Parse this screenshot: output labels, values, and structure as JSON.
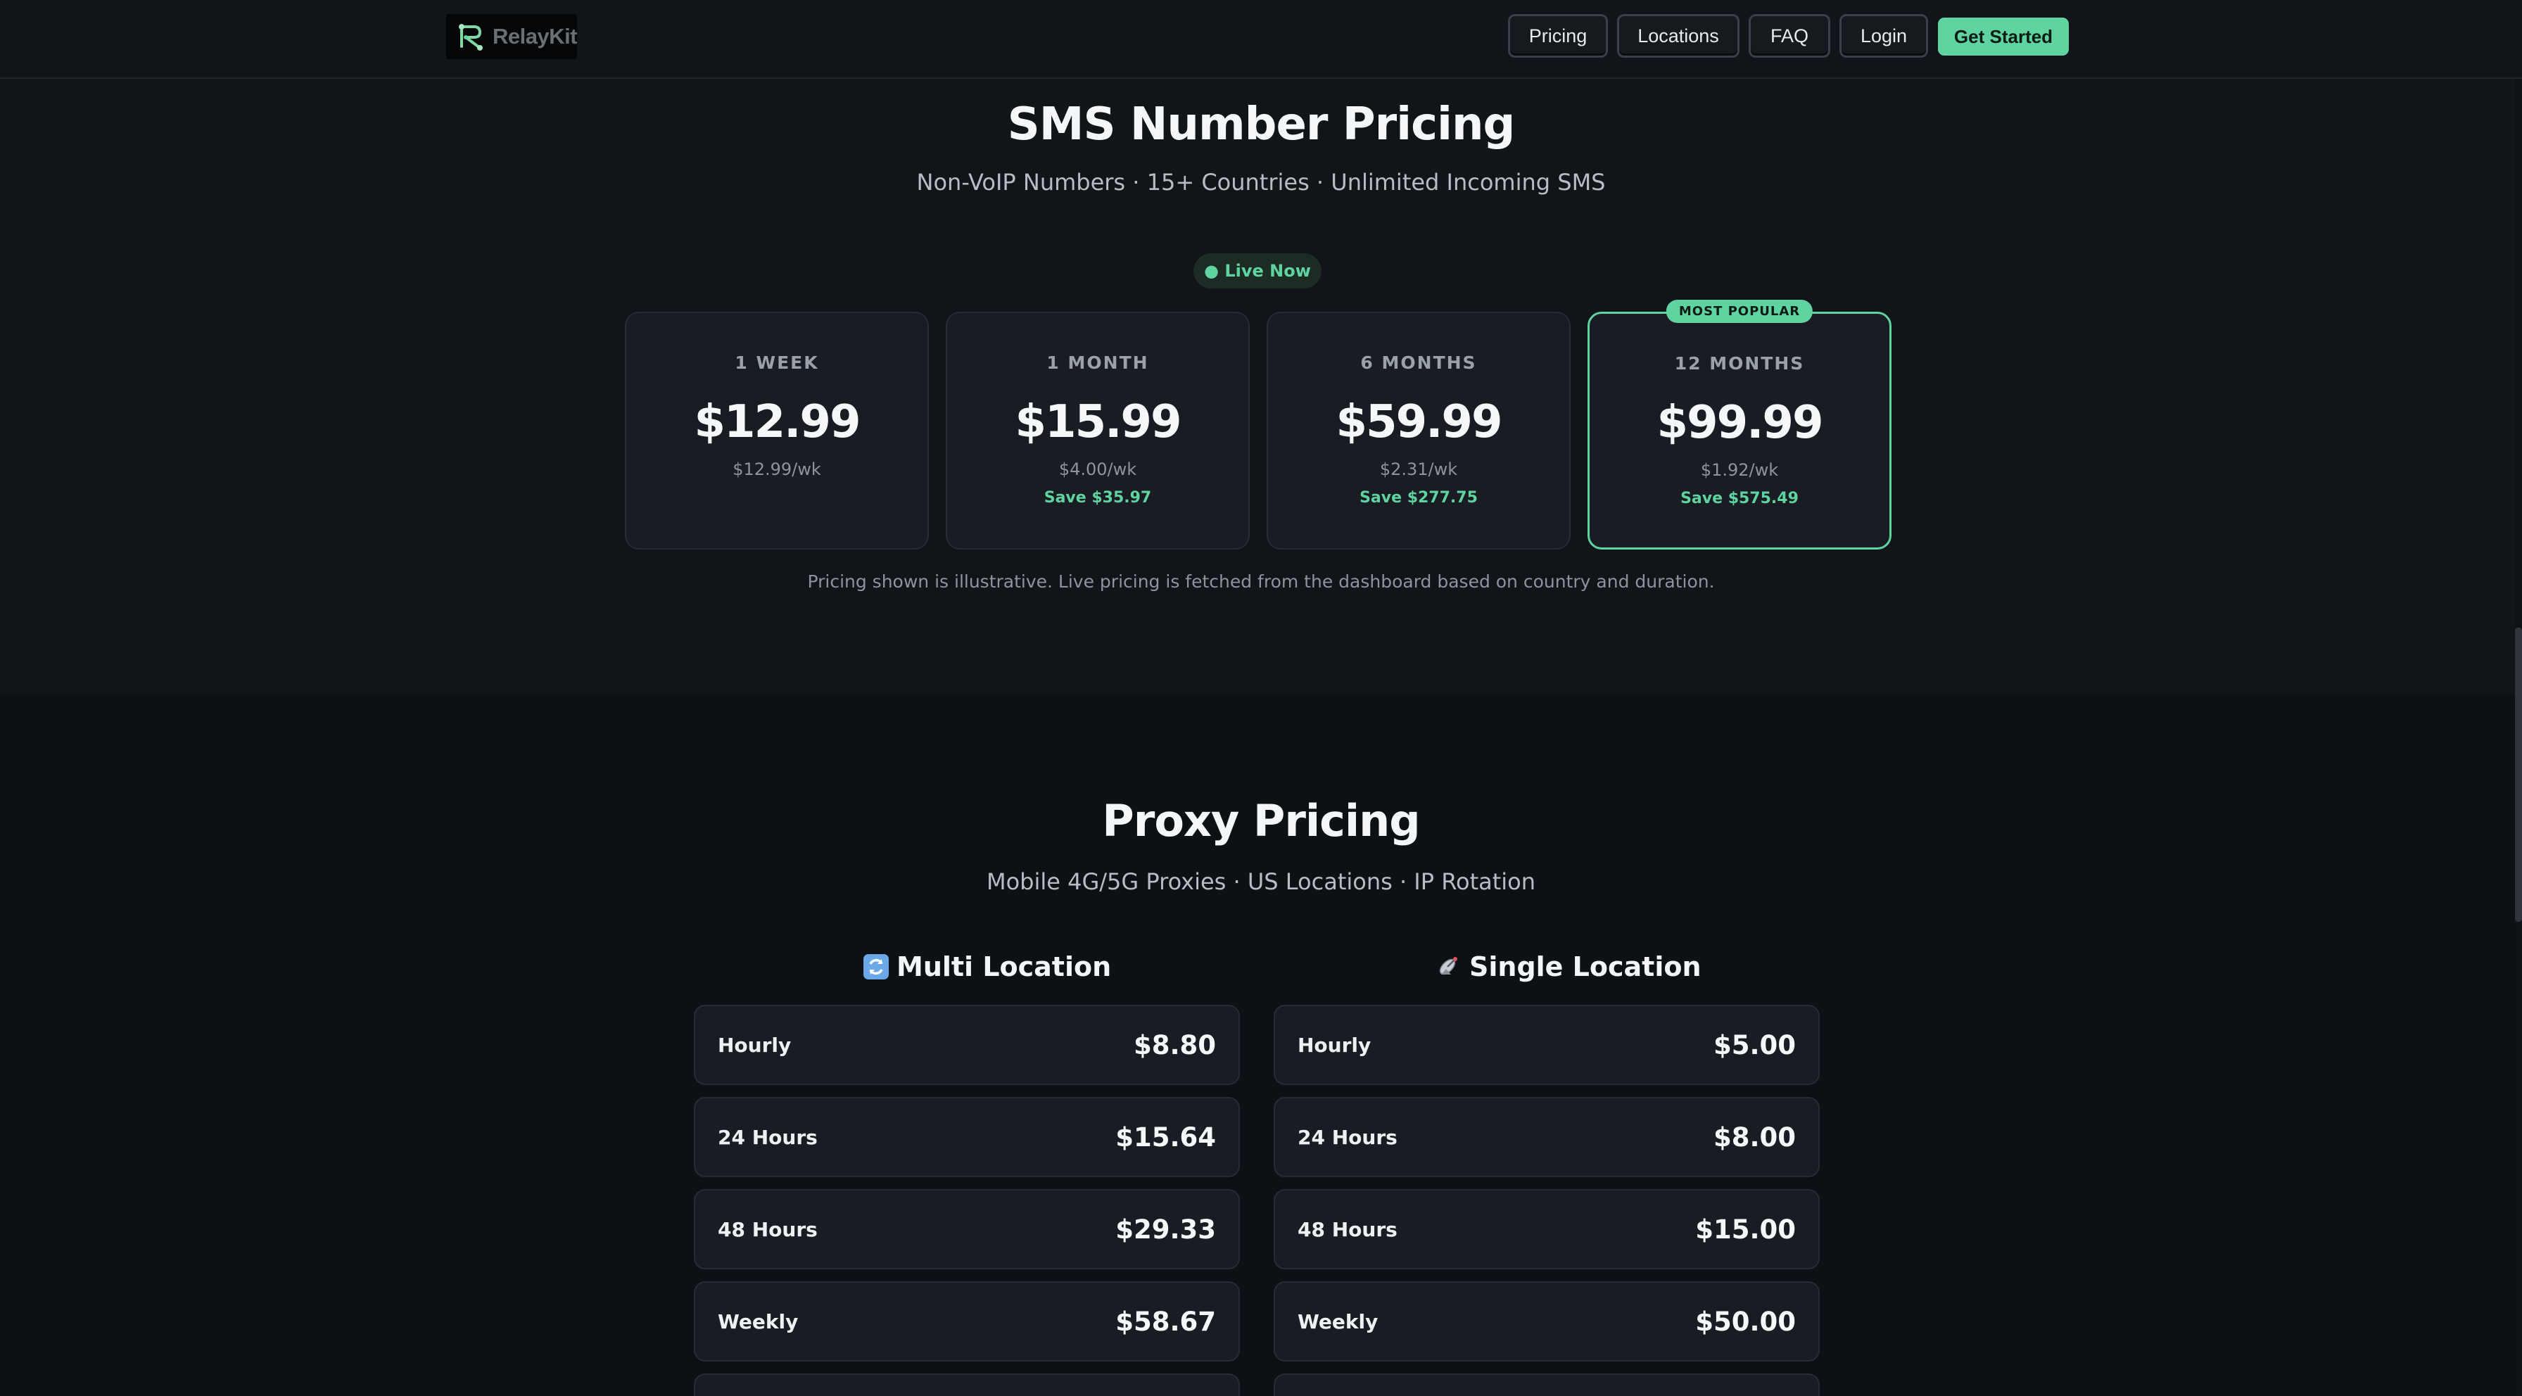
{
  "header": {
    "logo_text": "RelayKit",
    "nav": [
      "Pricing",
      "Locations",
      "FAQ",
      "Login"
    ],
    "cta_label": "Get Started"
  },
  "sms": {
    "title": "SMS Number Pricing",
    "subtitle": "Non-VoIP Numbers · 15+ Countries · Unlimited Incoming SMS",
    "live_badge": "● Live Now",
    "plans": [
      {
        "period": "1 WEEK",
        "price": "$12.99",
        "per_week": "$12.99/wk",
        "save": ""
      },
      {
        "period": "1 MONTH",
        "price": "$15.99",
        "per_week": "$4.00/wk",
        "save": "Save $35.97"
      },
      {
        "period": "6 MONTHS",
        "price": "$59.99",
        "per_week": "$2.31/wk",
        "save": "Save $277.75"
      },
      {
        "period": "12 MONTHS",
        "price": "$99.99",
        "per_week": "$1.92/wk",
        "save": "Save $575.49",
        "badge": "MOST POPULAR"
      }
    ],
    "note": "Pricing shown is illustrative. Live pricing is fetched from the dashboard based on country and duration."
  },
  "proxy": {
    "title": "Proxy Pricing",
    "subtitle": "Mobile 4G/5G Proxies · US Locations · IP Rotation",
    "multi": {
      "title": "Multi Location",
      "icon": "rotate-arrows-icon",
      "rows": [
        {
          "label": "Hourly",
          "price": "$8.80"
        },
        {
          "label": "24 Hours",
          "price": "$15.64"
        },
        {
          "label": "48 Hours",
          "price": "$29.33"
        },
        {
          "label": "Weekly",
          "price": "$58.67"
        }
      ]
    },
    "single": {
      "title": "Single Location",
      "icon": "satellite-antenna-icon",
      "rows": [
        {
          "label": "Hourly",
          "price": "$5.00"
        },
        {
          "label": "24 Hours",
          "price": "$8.00"
        },
        {
          "label": "48 Hours",
          "price": "$15.00"
        },
        {
          "label": "Weekly",
          "price": "$50.00"
        }
      ]
    }
  },
  "colors": {
    "accent": "#5fd3a0",
    "background": "#111418",
    "card": "#191d23"
  }
}
